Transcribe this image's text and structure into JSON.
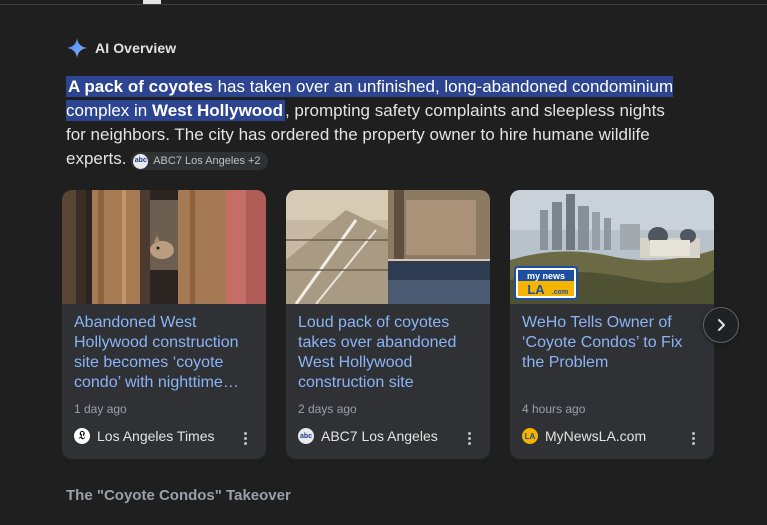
{
  "header": {
    "title": "AI Overview"
  },
  "overview": {
    "highlight_bold_1": "A pack of coyotes",
    "highlight_text_1": " has taken over an unfinished, long-abandoned condominium complex in ",
    "highlight_bold_2": "West Hollywood",
    "body": ", prompting safety complaints and sleepless nights for neighbors. The city has ordered the property owner to hire humane wildlife experts.",
    "source_chip": "ABC7 Los Angeles +2"
  },
  "cards": [
    {
      "title": "Abandoned West Hollywood construction site becomes ‘coyote condo’ with nighttime…",
      "time": "1 day ago",
      "source": "Los Angeles Times",
      "logo": "lat-icon"
    },
    {
      "title": "Loud pack of coyotes takes over abandoned West Hollywood construction site",
      "time": "2 days ago",
      "source": "ABC7 Los Angeles",
      "logo": "abc7-icon"
    },
    {
      "title": "WeHo Tells Owner of ‘Coyote Condos’ to Fix the Problem",
      "time": "4 hours ago",
      "source": "MyNewsLA.com",
      "logo": "mynewsla-icon"
    }
  ],
  "thumb3_badge": {
    "line1": "my news",
    "line2": "LA",
    "line3": ".com"
  },
  "section_heading": "The \"Coyote Condos\" Takeover",
  "colors": {
    "link": "#8ab4f8",
    "highlight": "#2d4590",
    "background": "#1f1f1f",
    "card": "#303134"
  }
}
